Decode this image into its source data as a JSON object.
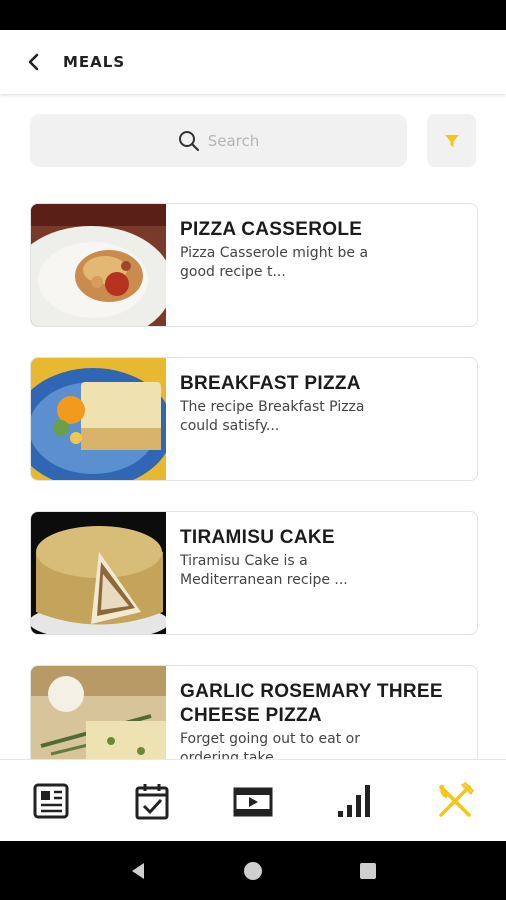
{
  "header": {
    "title": "MEALS"
  },
  "search": {
    "placeholder": "Search"
  },
  "meals": [
    {
      "title": "PIZZA CASSEROLE",
      "desc_line1": "Pizza Casserole might be a",
      "desc_line2": "good recipe t..."
    },
    {
      "title": "BREAKFAST PIZZA",
      "desc_line1": "The recipe Breakfast Pizza",
      "desc_line2": "could satisfy..."
    },
    {
      "title": "TIRAMISU CAKE",
      "desc_line1": "Tiramisu Cake is a",
      "desc_line2": "Mediterranean recipe ..."
    },
    {
      "title_line1": "GARLIC ROSEMARY THREE",
      "title_line2": "CHEESE PIZZA",
      "desc_line1": "Forget going out to eat or",
      "desc_line2": "ordering take..."
    }
  ],
  "bottom_nav": [
    {
      "icon": "news-icon",
      "active": false
    },
    {
      "icon": "calendar-check-icon",
      "active": false
    },
    {
      "icon": "video-icon",
      "active": false
    },
    {
      "icon": "bar-chart-icon",
      "active": false
    },
    {
      "icon": "fork-knife-icon",
      "active": true
    }
  ],
  "colors": {
    "accent": "#F5C518",
    "icon_dark": "#222222"
  }
}
